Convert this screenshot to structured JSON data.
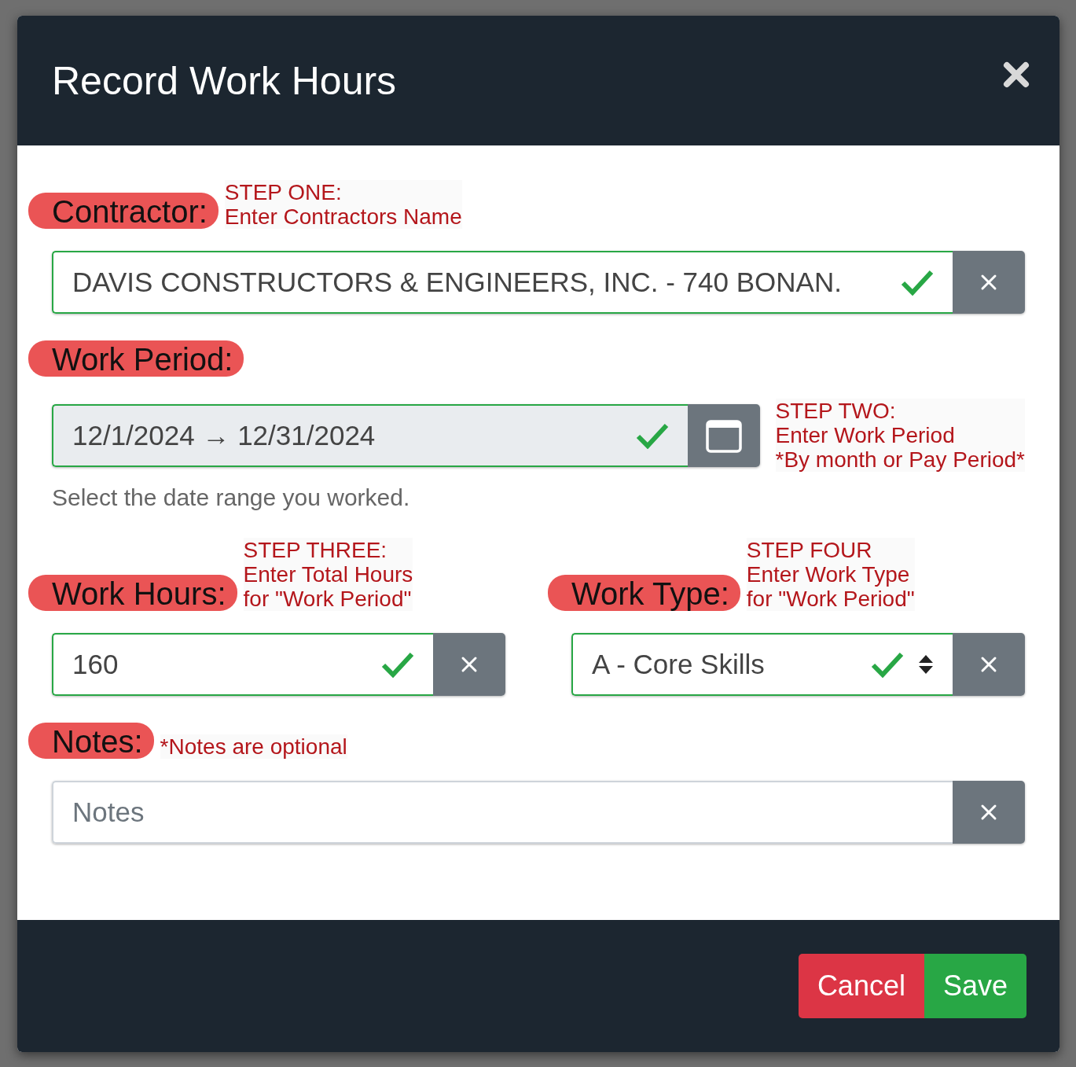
{
  "window": {
    "title": "Record Work Hours"
  },
  "rows": [
    [
      {
        "kind": "text",
        "label": "Contractor:",
        "label_note": [
          "STEP ONE:",
          "Enter Contractors Name"
        ],
        "value": "DAVIS CONSTRUCTORS & ENGINEERS, INC. - 740 BONAN.",
        "valid": true
      }
    ],
    [
      {
        "kind": "date_range",
        "label": "Work Period:",
        "field_note": [
          "STEP TWO:",
          "Enter Work Period",
          "*By month or Pay Period*"
        ],
        "value": "12/1/2024 → 12/31/2024",
        "valid": true,
        "help": "Select the date range you worked."
      }
    ],
    [
      {
        "kind": "text",
        "label": "Work Hours:",
        "label_note": [
          "STEP THREE:",
          "Enter Total Hours",
          "for \"Work Period\""
        ],
        "value": "160",
        "valid": true
      },
      {
        "kind": "select",
        "label": "Work Type:",
        "label_note": [
          "STEP FOUR",
          "Enter Work Type",
          "for \"Work Period\""
        ],
        "value": "A - Core Skills",
        "valid": true
      }
    ],
    [
      {
        "kind": "text",
        "label": "Notes:",
        "label_note": [
          "*Notes are optional"
        ],
        "placeholder": "Notes",
        "valid": false
      }
    ]
  ],
  "buttons": [
    {
      "label": "Cancel",
      "kind": "danger"
    },
    {
      "label": "Save",
      "kind": "success"
    }
  ]
}
